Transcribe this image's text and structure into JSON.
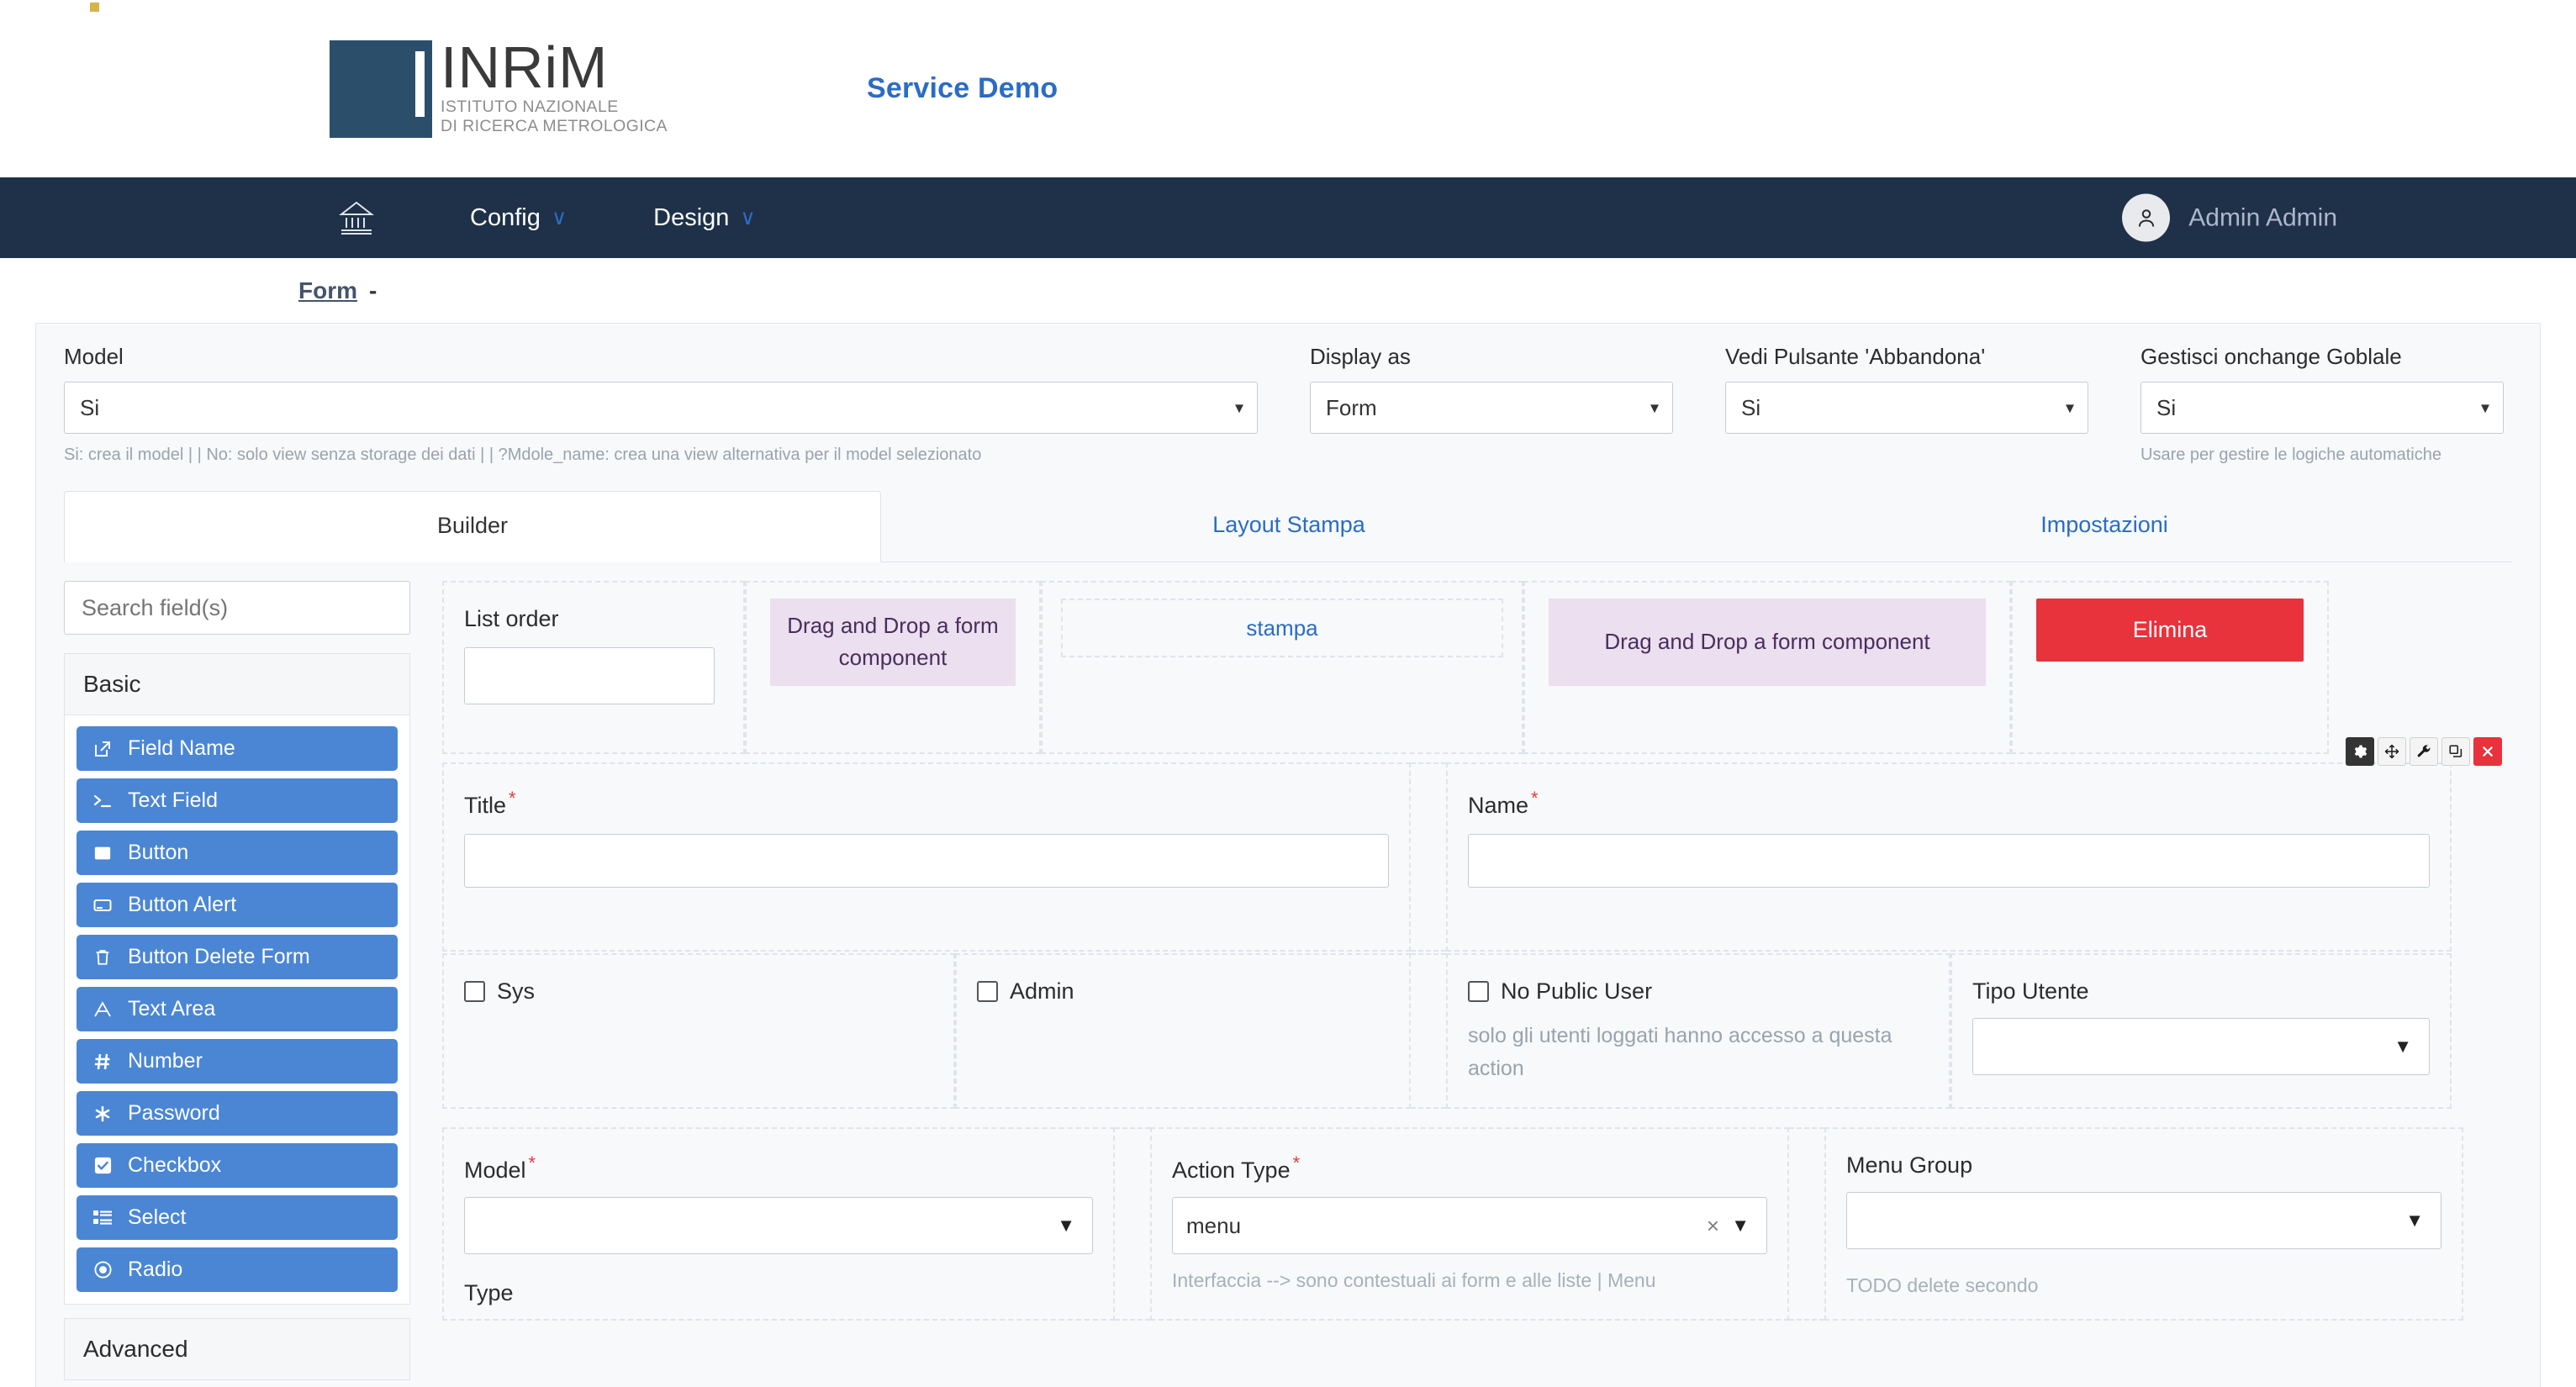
{
  "brand": {
    "logo_name": "INRiM",
    "logo_subtitle_line1": "ISTITUTO NAZIONALE",
    "logo_subtitle_line2": "DI RICERCA METROLOGICA",
    "app_title": "Service Demo",
    "accent_blue": "#2b6cc4",
    "navy": "#1e3149",
    "logo_navy": "#2b4f6b",
    "logo_dot": "#d6b44a"
  },
  "navbar": {
    "home_icon": "bank-icon",
    "items": [
      {
        "label": "Config",
        "caret": "∨"
      },
      {
        "label": "Design",
        "caret": "∨"
      }
    ],
    "user": {
      "name": "Admin Admin",
      "avatar_icon": "user-icon"
    }
  },
  "breadcrumb": {
    "link": "Form",
    "separator": "-"
  },
  "settings": {
    "model": {
      "label": "Model",
      "value": "Si",
      "hint": "Si: crea il model | | No: solo view senza storage dei dati | | ?Mdole_name: crea una view alternativa per il model selezionato"
    },
    "display_as": {
      "label": "Display as",
      "value": "Form"
    },
    "vedi_pulsante": {
      "label": "Vedi Pulsante 'Abbandona'",
      "value": "Si"
    },
    "gestisci_onchange": {
      "label": "Gestisci onchange Goblale",
      "value": "Si",
      "hint": "Usare per gestire le logiche automatiche"
    }
  },
  "tabs": [
    {
      "label": "Builder",
      "active": true
    },
    {
      "label": "Layout Stampa",
      "active": false
    },
    {
      "label": "Impostazioni",
      "active": false
    }
  ],
  "sidebar": {
    "search_placeholder": "Search field(s)",
    "groups": [
      {
        "title": "Basic",
        "items": [
          {
            "label": "Field Name",
            "icon": "external-link-icon"
          },
          {
            "label": "Text Field",
            "icon": "terminal-icon"
          },
          {
            "label": "Button",
            "icon": "square-filled-icon"
          },
          {
            "label": "Button Alert",
            "icon": "rectangle-outline-icon"
          },
          {
            "label": "Button Delete Form",
            "icon": "trash-icon"
          },
          {
            "label": "Text Area",
            "icon": "letter-a-icon"
          },
          {
            "label": "Number",
            "icon": "hash-icon"
          },
          {
            "label": "Password",
            "icon": "asterisk-icon"
          },
          {
            "label": "Checkbox",
            "icon": "checkbox-checked-icon"
          },
          {
            "label": "Select",
            "icon": "list-icon"
          },
          {
            "label": "Radio",
            "icon": "radio-dot-icon"
          }
        ]
      },
      {
        "title": "Advanced",
        "items": []
      }
    ]
  },
  "canvas": {
    "row1": {
      "list_order": {
        "label": "List order",
        "value": ""
      },
      "dropzone_1": "Drag and Drop a form component",
      "stampa_link": "stampa",
      "dropzone_2": "Drag and Drop a form component",
      "elimina_button": "Elimina"
    },
    "row2": {
      "title": {
        "label": "Title",
        "required": "*",
        "value": ""
      },
      "name": {
        "label": "Name",
        "required": "*",
        "value": ""
      },
      "toolbar": [
        {
          "icon": "gear-icon",
          "style": "dark"
        },
        {
          "icon": "move-icon",
          "style": "light"
        },
        {
          "icon": "wrench-icon",
          "style": "light"
        },
        {
          "icon": "copy-icon",
          "style": "light"
        },
        {
          "icon": "close-icon",
          "style": "red"
        }
      ]
    },
    "row3": {
      "sys": {
        "label": "Sys",
        "checked": false
      },
      "admin": {
        "label": "Admin",
        "checked": false
      },
      "no_public_user": {
        "label": "No Public User",
        "checked": false,
        "hint": "solo gli utenti loggati hanno accesso a questa action"
      },
      "tipo_utente": {
        "label": "Tipo Utente",
        "value": ""
      }
    },
    "row4": {
      "model": {
        "label": "Model",
        "required": "*",
        "value": "",
        "sub_label": "Type"
      },
      "action_type": {
        "label": "Action Type",
        "required": "*",
        "value": "menu",
        "clear_icon": "×",
        "hint": "Interfaccia --> sono contestuali ai form e alle liste | Menu"
      },
      "menu_group": {
        "label": "Menu Group",
        "value": "",
        "hint": "TODO delete secondo"
      }
    }
  }
}
